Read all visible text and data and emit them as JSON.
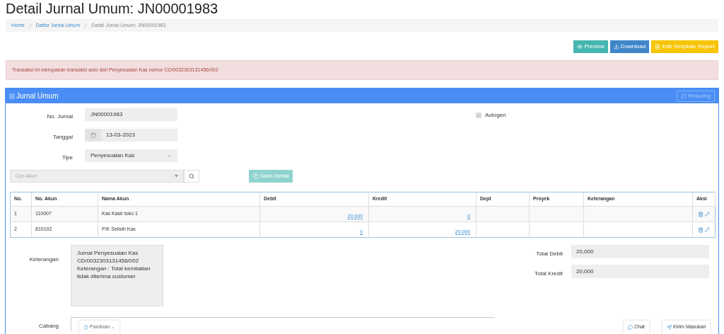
{
  "title": "Detail Jurnal Umum: JN00001983",
  "breadcrumb": [
    {
      "label": "Home",
      "kind": "link"
    },
    {
      "label": "Daftar Jurnal Umum",
      "kind": "link"
    },
    {
      "label": "Detail Jurnal Umum: JN00001983",
      "kind": "current"
    }
  ],
  "actions": [
    {
      "label": "Preview",
      "kind": "preview"
    },
    {
      "label": "Download",
      "kind": "download"
    },
    {
      "label": "Edit Template Report",
      "kind": "template"
    }
  ],
  "alert": "Transaksi ini merupakan transaksi auto dari Penyesuaian Kas nomor CD/0032303131456/002",
  "panel": {
    "title": "Jurnal Umum",
    "rekuring": {
      "label": "Rekuring",
      "disabled": true
    },
    "no_jurnal": {
      "label": "No. Jurnal",
      "value": "JN00001983"
    },
    "tanggal": {
      "label": "Tanggal",
      "value": "13-03-2023"
    },
    "tipe": {
      "label": "Tipe",
      "value": "Penyesuaian Kas"
    },
    "autogen": {
      "label": "Autogen",
      "checked": true
    },
    "cari_akun": {
      "placeholder": "Cari Akun"
    },
    "salin_detail": {
      "label": "Salin Detail",
      "disabled": true
    },
    "table": {
      "columns": [
        "No.",
        "No. Akun",
        "Nama Akun",
        "Debit",
        "Kredit",
        "Dept",
        "Proyek",
        "Keterangan",
        "Aksi"
      ],
      "rows": [
        {
          "no": "1",
          "akun": "110007",
          "nama": "Kas Kasir toko 1",
          "debit": "20,000",
          "kredit": "0"
        },
        {
          "no": "2",
          "akun": "810102",
          "nama": "P/K Selisih Kas",
          "debit": "0",
          "kredit": "20,000"
        }
      ]
    },
    "keterangan": {
      "label": "Keterangan",
      "value": "Jurnal Penyesuaian Kas\nCD/0032303131456/002\nKeterangan : Total kembalian tidak diterima customer"
    },
    "total_debit": {
      "label": "Total Debit",
      "value": "20,000"
    },
    "total_kredit": {
      "label": "Total Kredit",
      "value": "20,000"
    },
    "cabang": {
      "label": "Cabang"
    }
  },
  "floating": {
    "panduan": "Panduan",
    "chat": "Chat",
    "kirim": "Kirim Masukan"
  }
}
